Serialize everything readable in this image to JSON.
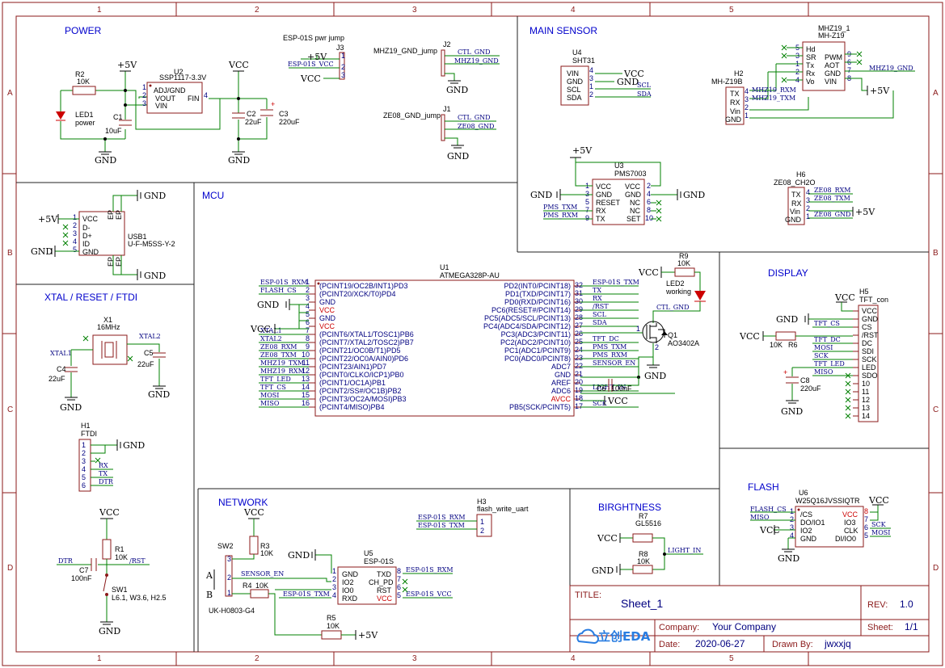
{
  "grid": {
    "cols": [
      "1",
      "2",
      "3",
      "4",
      "5"
    ],
    "rows": [
      "A",
      "B",
      "C",
      "D"
    ]
  },
  "sections": {
    "power": "POWER",
    "main_sensor": "MAIN SENSOR",
    "mcu": "MCU",
    "xtal": "XTAL / RESET / FTDI",
    "display": "DISPLAY",
    "network": "NETWORK",
    "brightness": "BIRGHTNESS",
    "flash": "FLASH"
  },
  "power": {
    "r2_ref": "R2",
    "r2_val": "10K",
    "led1_ref": "LED1",
    "led1_val": "power",
    "c1_ref": "C1",
    "c1_val": "10uF",
    "u2_ref": "U2",
    "u2_val": "SSP1117-3.3V",
    "u2_pins": [
      "ADJ/GND",
      "VOUT",
      "VIN",
      "FIN"
    ],
    "c2_ref": "C2",
    "c2_val": "22uF",
    "c3_ref": "C3",
    "c3_val": "220uF",
    "j3_title": "ESP-01S pwr jump",
    "j3_ref": "J3",
    "j3_net1": "+5V",
    "j3_net2": "ESP-01S_VCC",
    "j3_net3": "VCC",
    "j2_title": "MHZ19_GND_jump",
    "j2_ref": "J2",
    "j2_net1": "CTL_GND",
    "j2_net2": "MHZ19_GND",
    "j1_title": "ZE08_GND_jump",
    "j1_ref": "J1",
    "j1_net1": "CTL_GND",
    "j1_net2": "ZE08_GND"
  },
  "sensor": {
    "u4_ref": "U4",
    "u4_val": "SHT31",
    "u4_pins": [
      "VIN",
      "GND",
      "SCL",
      "SDA"
    ],
    "u4_nets": [
      "VCC",
      "GND",
      "SCL",
      "SDA"
    ],
    "mhz_ref": "MHZ19_1",
    "mhz_val": "MH-Z19",
    "mhz_left": [
      "Hd",
      "SR",
      "Tx",
      "Rx",
      "Vo"
    ],
    "mhz_right": [
      "PWM",
      "AOT",
      "GND",
      "VIN"
    ],
    "h2_ref": "H2",
    "h2_val": "MH-Z19B",
    "h2_pins": [
      "TX",
      "RX",
      "Vin",
      "GND"
    ],
    "h2_nets": [
      "MHZ19_RXM",
      "MHZ19_TXM"
    ],
    "mhz_gnd": "MHZ19_GND",
    "p5v": "+5V",
    "u3_ref": "U3",
    "u3_val": "PMS7003",
    "u3_left": [
      "VCC",
      "GND",
      "RESET",
      "RX",
      "TX"
    ],
    "u3_right": [
      "VCC",
      "GND",
      "NC",
      "NC",
      "SET"
    ],
    "u3_nets": [
      "PMS_TXM",
      "PMS_RXM"
    ],
    "h6_ref": "H6",
    "h6_val": "ZE08_CH2O",
    "h6_pins": [
      "TX",
      "RX",
      "Vin",
      "GND"
    ],
    "h6_nets": [
      "ZE08_RXM",
      "ZE08_TXM",
      "ZE08_GND"
    ]
  },
  "usb": {
    "ref": "USB1",
    "val": "U-F-M5SS-Y-2",
    "pins": [
      "VCC",
      "D-",
      "D+",
      "ID",
      "GND"
    ],
    "ep": "EP"
  },
  "xtal": {
    "x1_ref": "X1",
    "x1_val": "16MHz",
    "xtal1": "XTAL1",
    "xtal2": "XTAL2",
    "c4_ref": "C4",
    "c4_val": "22uF",
    "c5_ref": "C5",
    "c5_val": "22uF",
    "h1_ref": "H1",
    "h1_val": "FTDI",
    "h1_nets": [
      "RX",
      "TX",
      "DTR"
    ],
    "r1_ref": "R1",
    "r1_val": "10K",
    "rst": "/RST",
    "dtr": "DTR",
    "c7_ref": "C7",
    "c7_val": "100nF",
    "sw1_ref": "SW1",
    "sw1_val": "L6.1, W3.6, H2.5"
  },
  "mcu": {
    "ref": "U1",
    "val": "ATMEGA328P-AU",
    "left": [
      [
        "1",
        "(PCINT19/OC2B/INT1)PD3",
        "ESP-01S_RXM"
      ],
      [
        "2",
        "(PCINT20/XCK/T0)PD4",
        "FLASH_CS"
      ],
      [
        "3",
        "GND",
        ""
      ],
      [
        "4",
        "VCC",
        ""
      ],
      [
        "5",
        "GND",
        ""
      ],
      [
        "6",
        "VCC",
        ""
      ],
      [
        "7",
        "(PCINT6/XTAL1/TOSC1)PB6",
        "XTAL1"
      ],
      [
        "8",
        "(PCINT7/XTAL2/TOSC2)PB7",
        "XTAL2"
      ],
      [
        "9",
        "(PCINT21/OC0B/T1)PD5",
        "ZE08_RXM"
      ],
      [
        "10",
        "(PCINT22/OC0A/AIN0)PD6",
        "ZE08_TXM"
      ],
      [
        "11",
        "(PCINT23/AIN1)PD7",
        "MHZ19_TXM"
      ],
      [
        "12",
        "(PCINT0/CLKO/ICP1)PB0",
        "MHZ19_RXM"
      ],
      [
        "13",
        "(PCINT1/OC1A)PB1",
        "TFT_LED"
      ],
      [
        "14",
        "(PCINT2/SS#/OC1B)PB2",
        "TFT_CS"
      ],
      [
        "15",
        "(PCINT3/OC2A/MOSI)PB3",
        "MOSI"
      ],
      [
        "16",
        "(PCINT4/MISO)PB4",
        "MISO"
      ]
    ],
    "right": [
      [
        "32",
        "PD2(INT0/PCINT18)",
        "ESP-01S_TXM"
      ],
      [
        "31",
        "PD1(TXD/PCINT17)",
        "TX"
      ],
      [
        "30",
        "PD0(RXD/PCINT16)",
        "RX"
      ],
      [
        "29",
        "PC6(RESET#/PCINT14)",
        "/RST"
      ],
      [
        "28",
        "PC5(ADC5/SCL/PCINT13)",
        "SCL"
      ],
      [
        "27",
        "PC4(ADC4/SDA/PCINT12)",
        "SDA"
      ],
      [
        "26",
        "PC3(ADC3/PCINT11)",
        ""
      ],
      [
        "25",
        "PC2(ADC2/PCINT10)",
        "TFT_DC"
      ],
      [
        "24",
        "PC1(ADC1/PCINT9)",
        "PMS_TXM"
      ],
      [
        "23",
        "PC0(ADC0/PCINT8)",
        "PMS_RXM"
      ],
      [
        "22",
        "ADC7",
        "SENSOR_EN"
      ],
      [
        "21",
        "GND",
        ""
      ],
      [
        "20",
        "AREF",
        ""
      ],
      [
        "19",
        "ADC6",
        "LIGHT_IN"
      ],
      [
        "18",
        "AVCC",
        ""
      ],
      [
        "17",
        "PB5(SCK/PCINT5)",
        "SCK"
      ]
    ],
    "r9_ref": "R9",
    "r9_val": "10K",
    "led2_ref": "LED2",
    "led2_val": "working",
    "ctl_gnd": "CTL_GND",
    "q1_ref": "Q1",
    "q1_val": "AO3402A",
    "c6_ref": "C6",
    "c6_val": "100nF",
    "vcc": "VCC",
    "gnd": "GND"
  },
  "display": {
    "ref": "H5",
    "val": "TFT_con",
    "pins": [
      "VCC",
      "GND",
      "CS",
      "/RST",
      "DC",
      "SDI",
      "SCK",
      "LED",
      "SDO",
      "10",
      "11",
      "12",
      "13",
      "14"
    ],
    "nets": [
      "TFT_CS",
      "",
      "TFT_DC",
      "MOSI",
      "SCK",
      "TFT_LED",
      "MISO"
    ],
    "r6_ref": "R6",
    "r6_val": "10K",
    "c8_ref": "C8",
    "c8_val": "220uF"
  },
  "network": {
    "sw2_ref": "SW2",
    "sw2_val": "UK-H0803-G4",
    "r3_ref": "R3",
    "r3_val": "10K",
    "r4_ref": "R4",
    "r4_val": "10K",
    "r5_ref": "R5",
    "r5_val": "10K",
    "sensor_en": "SENSOR_EN",
    "u5_ref": "U5",
    "u5_val": "ESP-01S",
    "u5_left": [
      "GND",
      "IO2",
      "IO0",
      "RXD"
    ],
    "u5_right": [
      "TXD",
      "CH_PD",
      "RST",
      "VCC"
    ],
    "u5_nets": [
      "ESP-01S_RXM",
      "ESP-01S_VCC",
      "ESP-01S_TXM"
    ],
    "h3_ref": "H3",
    "h3_val": "flash_write_uart",
    "h3_nets": [
      "ESP-01S_RXM",
      "ESP-01S_TXM"
    ],
    "ab": [
      "A",
      "B"
    ]
  },
  "bright": {
    "r7_ref": "R7",
    "r7_val": "GL5516",
    "r8_ref": "R8",
    "r8_val": "10K",
    "light_in": "LIGHT_IN"
  },
  "flash": {
    "ref": "U6",
    "val": "W25Q16JVSSIQTR",
    "left": [
      "/CS",
      "DO/IO1",
      "IO2",
      "GND"
    ],
    "right": [
      "VCC",
      "IO3",
      "CLK",
      "DI/IO0"
    ],
    "nets": [
      "FLASH_CS",
      "MISO",
      "SCK",
      "MOSI"
    ]
  },
  "title_block": {
    "title_label": "TITLE:",
    "title": "Sheet_1",
    "rev_label": "REV:",
    "rev": "1.0",
    "company_label": "Company:",
    "company": "Your Company",
    "sheet_label": "Sheet:",
    "sheet": "1/1",
    "date_label": "Date:",
    "date": "2020-06-27",
    "drawn_label": "Drawn By:",
    "drawn": "jwxxjq",
    "logo": "立创EDA"
  },
  "power_labels": {
    "p5v": "+5V",
    "vcc": "VCC",
    "gnd": "GND"
  }
}
